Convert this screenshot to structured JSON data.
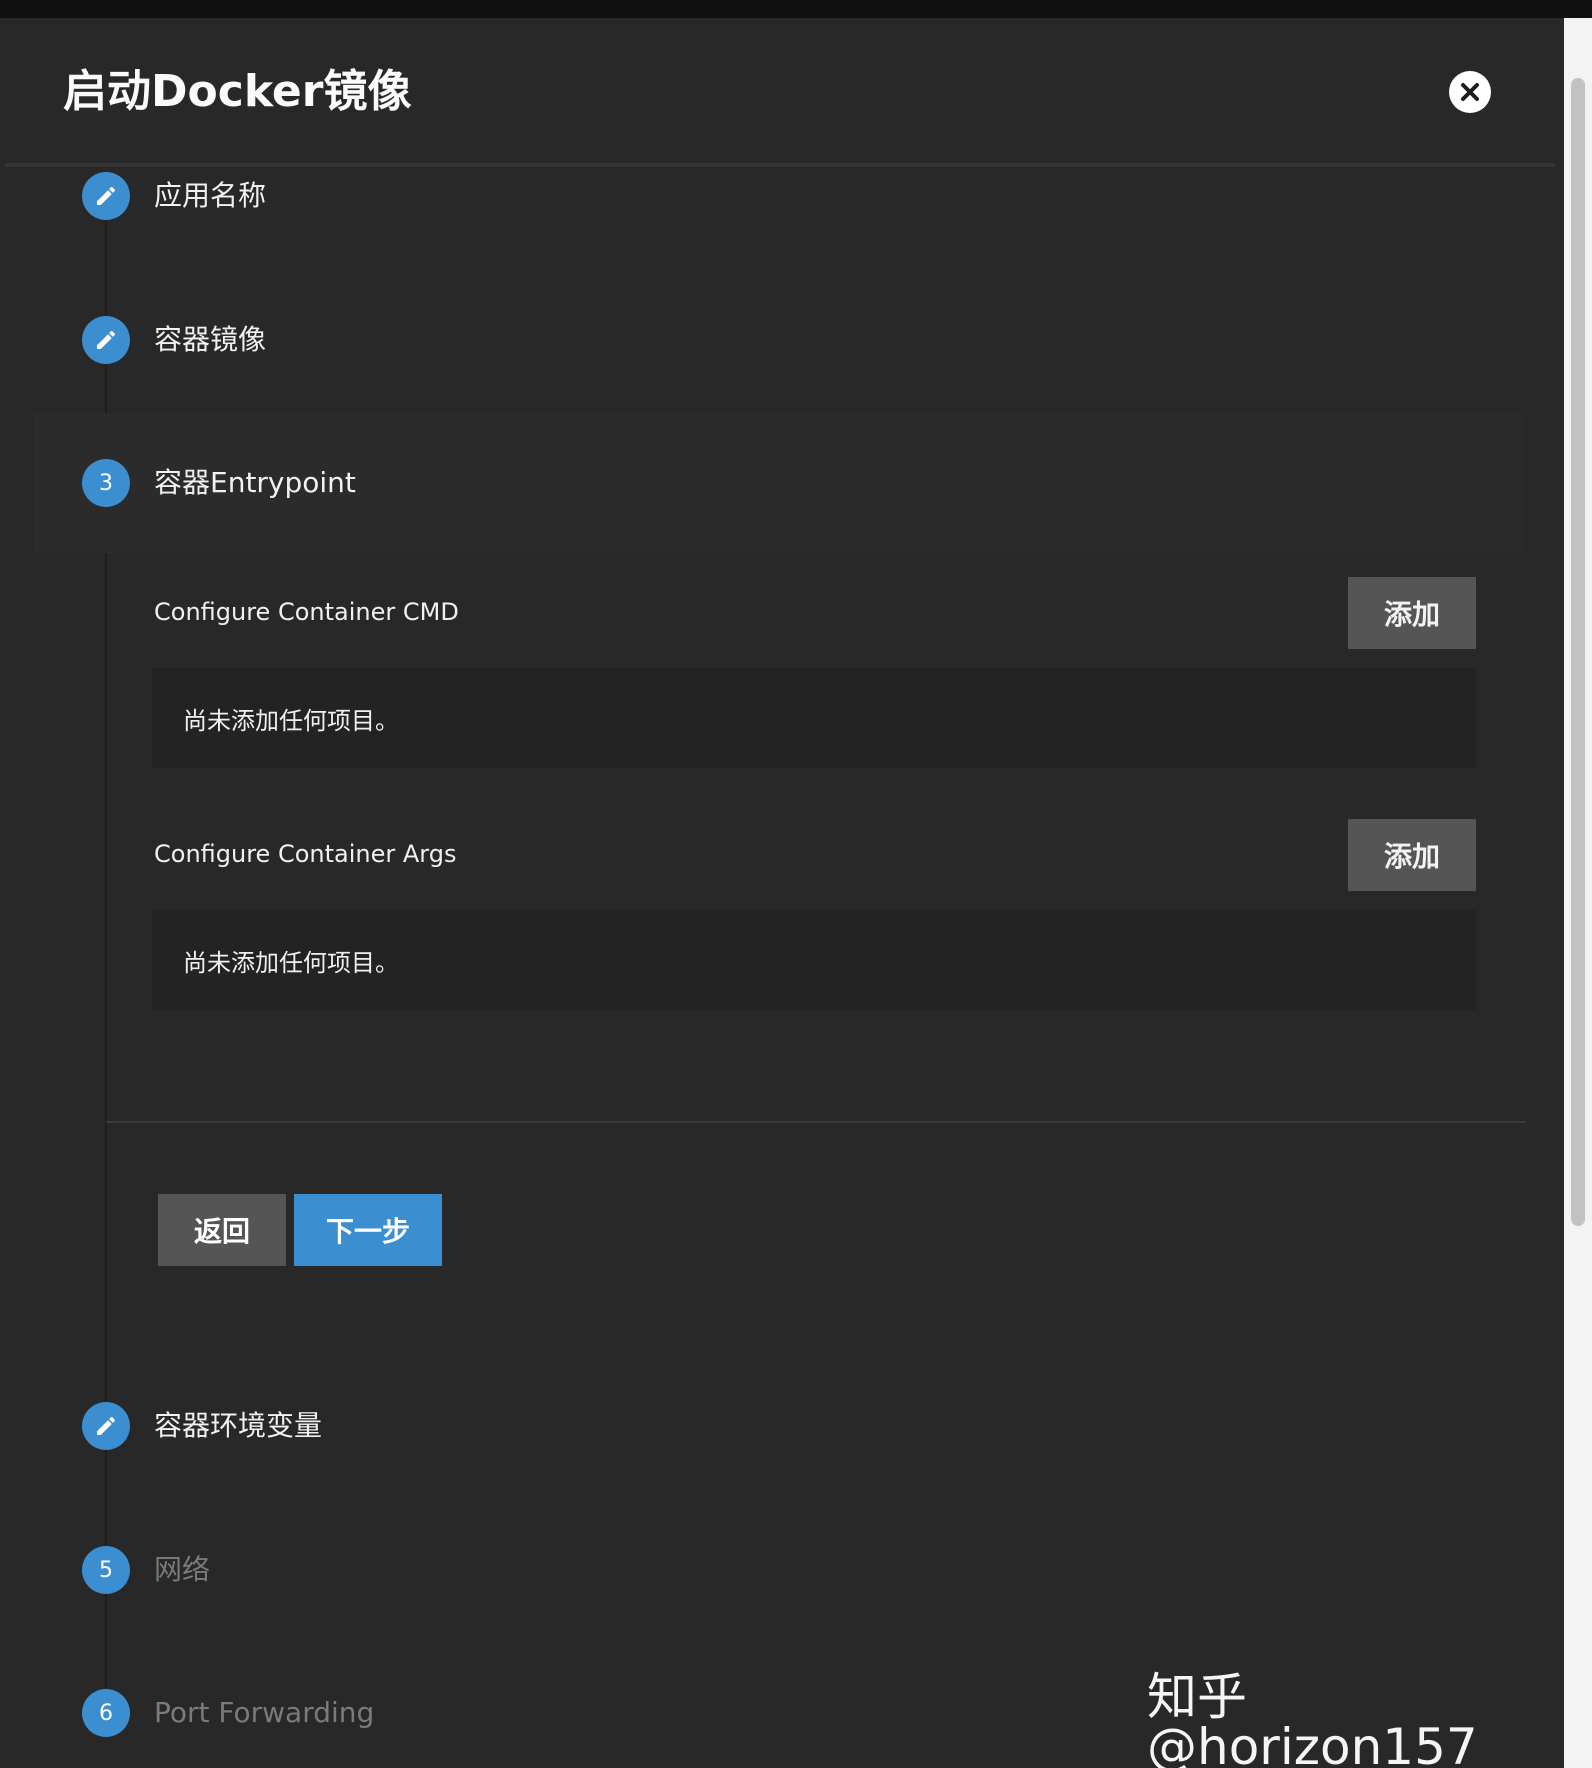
{
  "dialog": {
    "title": "启动Docker镜像"
  },
  "steps": [
    {
      "icon": "pencil-icon",
      "label": "应用名称"
    },
    {
      "icon": "pencil-icon",
      "label": "容器镜像"
    },
    {
      "number": "3",
      "label": "容器Entrypoint"
    },
    {
      "icon": "pencil-icon",
      "label": "容器环境变量"
    },
    {
      "number": "5",
      "label": "网络"
    },
    {
      "number": "6",
      "label": "Port Forwarding"
    }
  ],
  "entrypoint": {
    "cmd_label": "Configure Container CMD",
    "cmd_add": "添加",
    "cmd_empty": "尚未添加任何项目。",
    "args_label": "Configure Container Args",
    "args_add": "添加",
    "args_empty": "尚未添加任何项目。"
  },
  "actions": {
    "back": "返回",
    "next": "下一步"
  },
  "watermark": "知乎 @horizon157",
  "colors": {
    "accent": "#3b8ed0",
    "background": "#282828",
    "button_gray": "#555555"
  }
}
